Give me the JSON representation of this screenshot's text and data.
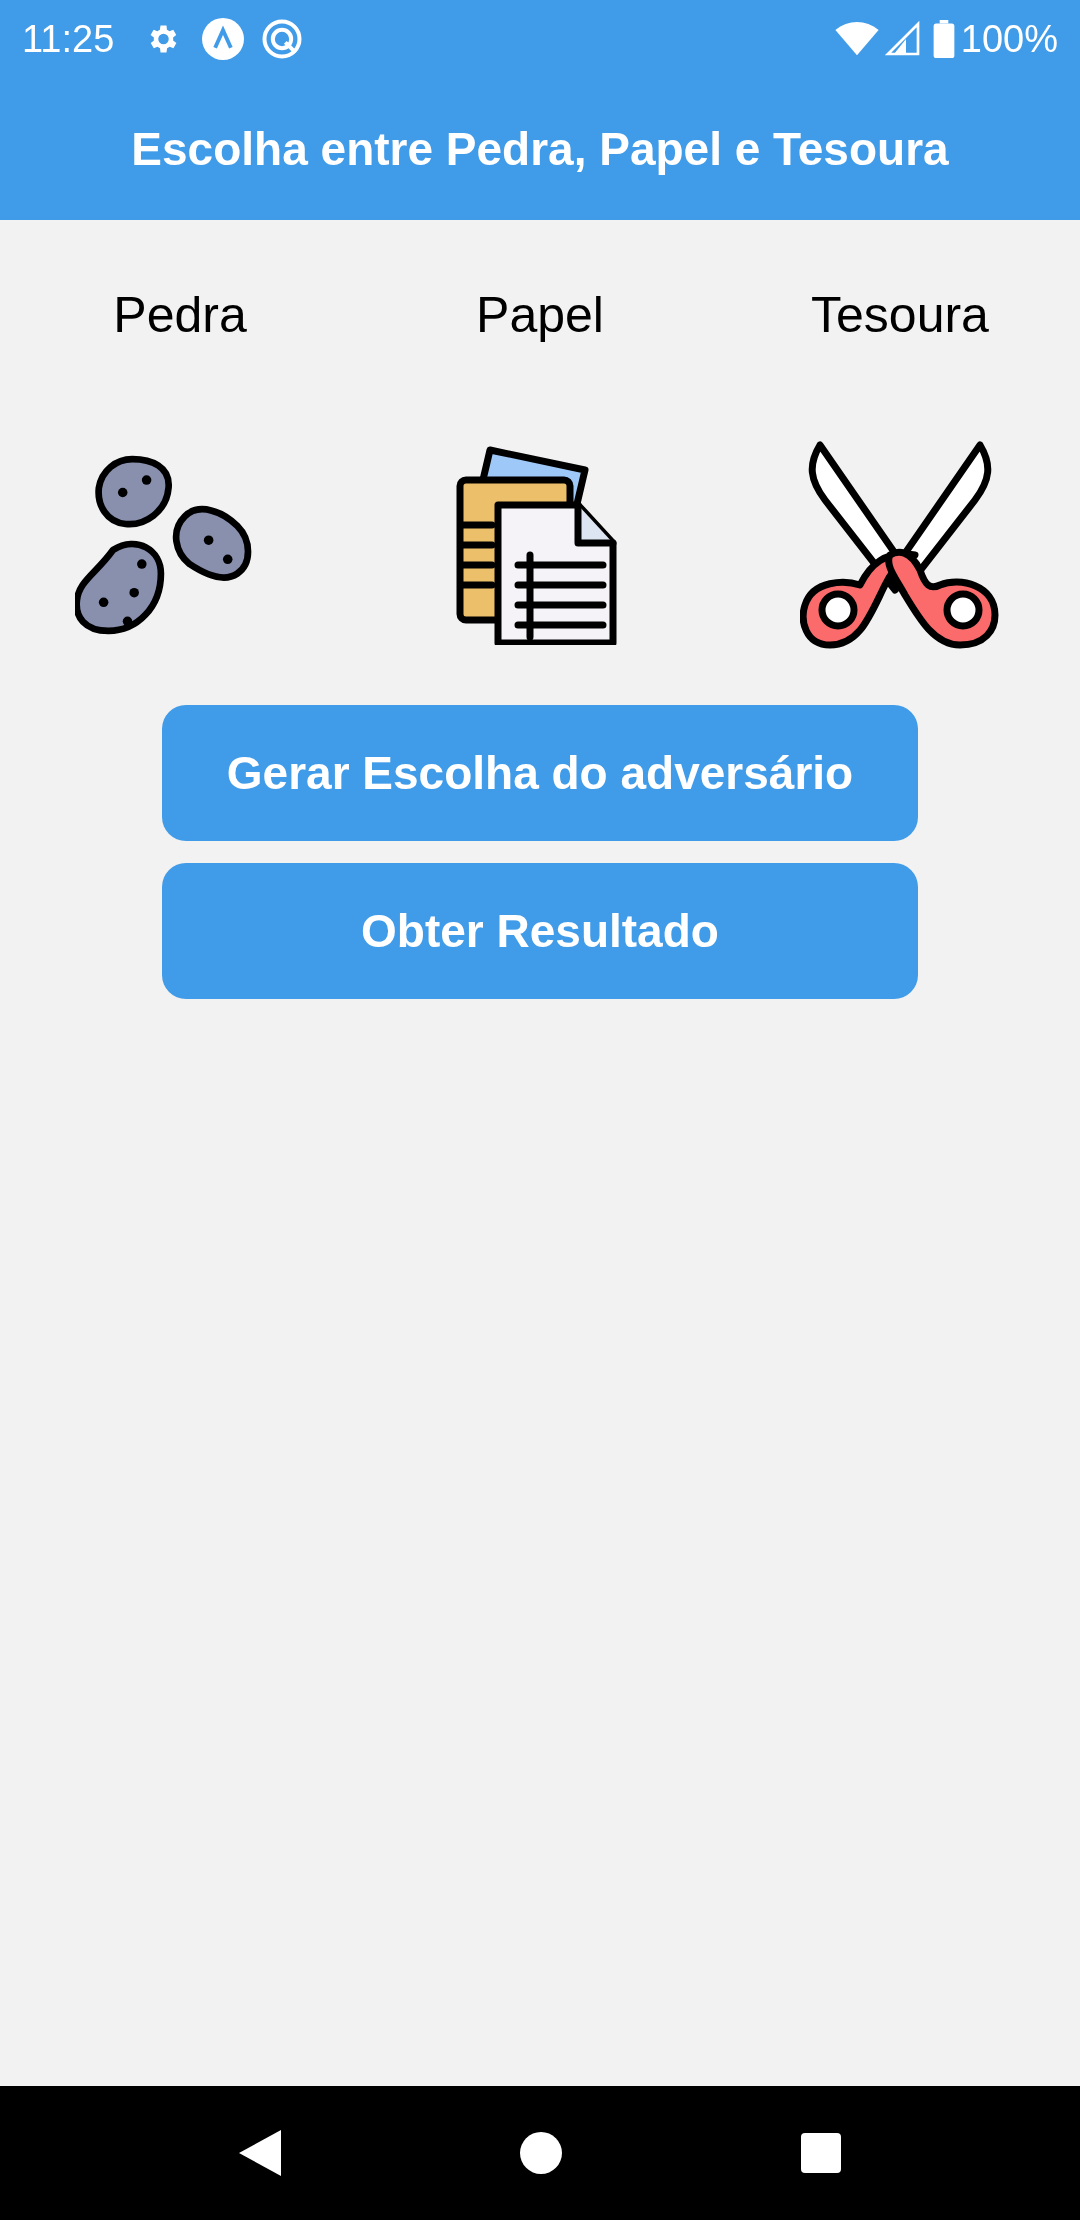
{
  "status_bar": {
    "time": "11:25",
    "battery": "100%"
  },
  "header": {
    "title": "Escolha entre Pedra, Papel e Tesoura"
  },
  "choices": [
    {
      "label": "Pedra",
      "kind": "rock"
    },
    {
      "label": "Papel",
      "kind": "paper"
    },
    {
      "label": "Tesoura",
      "kind": "scissors"
    }
  ],
  "buttons": [
    "Gerar Escolha do adversário",
    "Obter Resultado"
  ]
}
